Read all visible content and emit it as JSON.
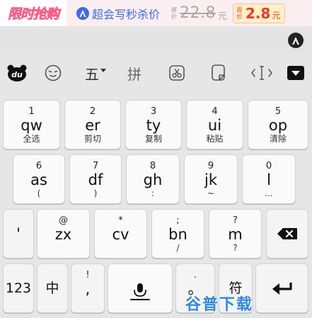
{
  "banner": {
    "logo_text": "限时抢购",
    "brand_icon": "brand-a-icon",
    "text": "超会写秒杀价",
    "orig_label": "原价",
    "orig_price": "22.8",
    "orig_unit": "元",
    "now_label": "现价",
    "now_price": "2.8",
    "now_unit": "元",
    "colors": {
      "logo": "#ff5a86",
      "brand": "#3a6bf0",
      "price": "#f0392b"
    }
  },
  "candidate_strip": {
    "icon": "keyboard-logo-icon"
  },
  "toolbar": {
    "items": [
      {
        "icon": "du-logo-icon"
      },
      {
        "icon": "emoji-icon"
      },
      {
        "label": "五",
        "icon": "chevron-down-icon"
      },
      {
        "label": "拼",
        "icon": "pinyin-icon"
      },
      {
        "icon": "scissors-icon"
      },
      {
        "icon": "clipboard-icon"
      },
      {
        "icon": "cursor-icon"
      },
      {
        "icon": "collapse-keyboard-icon"
      }
    ]
  },
  "keyboard": {
    "row1": [
      {
        "num": "1",
        "main": "qw",
        "sub": "全选"
      },
      {
        "num": "2",
        "main": "er",
        "sub": "剪切"
      },
      {
        "num": "3",
        "main": "ty",
        "sub": "复制"
      },
      {
        "num": "4",
        "main": "ui",
        "sub": "粘贴"
      },
      {
        "num": "5",
        "main": "op",
        "sub": "清除"
      }
    ],
    "row2": [
      {
        "num": "6",
        "main": "as",
        "sub": "("
      },
      {
        "num": "7",
        "main": "df",
        "sub": ")"
      },
      {
        "num": "8",
        "main": "gh",
        "sub": ":"
      },
      {
        "num": "9",
        "main": "jk",
        "sub": "~"
      },
      {
        "num": "0",
        "main": "l",
        "sub": "..."
      }
    ],
    "row3": [
      {
        "num": "",
        "main": "'",
        "sub": ""
      },
      {
        "num": "@",
        "main": "zx",
        "sub": ""
      },
      {
        "num": "*",
        "main": "cv",
        "sub": ""
      },
      {
        "num": ";",
        "main": "bn",
        "sub": "/"
      },
      {
        "num": "?",
        "main": "m",
        "sub": "?"
      },
      {
        "icon": "backspace-icon"
      }
    ],
    "row4": [
      {
        "main": "123"
      },
      {
        "main": "中"
      },
      {
        "num": "!",
        "main": ","
      },
      {
        "icon": "microphone-icon"
      },
      {
        "num": ".",
        "main": "。"
      },
      {
        "main": "符"
      },
      {
        "icon": "enter-icon"
      }
    ]
  },
  "watermark": {
    "text": "谷普下载"
  }
}
